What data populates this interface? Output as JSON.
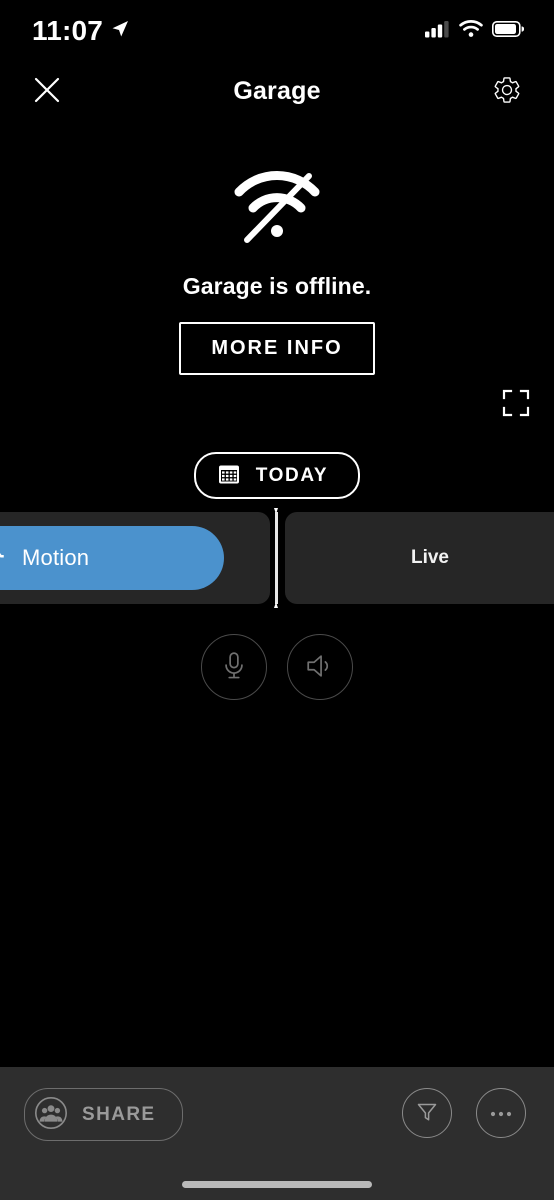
{
  "status_bar": {
    "time": "11:07",
    "location_icon": "location-arrow-icon",
    "signal_icon": "cellular-signal-icon",
    "signal_bars_filled": 2,
    "signal_bars_total": 4,
    "wifi_icon": "wifi-icon",
    "battery_icon": "battery-icon",
    "battery_level_percent": 85
  },
  "nav_bar": {
    "close_icon": "close-x-icon",
    "title": "Garage",
    "settings_icon": "gear-icon"
  },
  "offline_panel": {
    "icon": "wifi-off-icon",
    "message": "Garage is offline.",
    "more_info_label": "MORE INFO"
  },
  "viewer": {
    "fullscreen_icon": "fullscreen-expand-icon"
  },
  "date_selector": {
    "calendar_icon": "calendar-icon",
    "label": "TODAY"
  },
  "timeline": {
    "events": [
      {
        "type": "motion",
        "label": "Motion",
        "icon": "running-person-icon",
        "color": "#4b92cd"
      },
      {
        "type": "live",
        "label": "Live",
        "icon": "",
        "color": "#262626"
      }
    ],
    "playhead_label": "playhead"
  },
  "audio_controls": [
    {
      "name": "microphone",
      "icon": "microphone-icon",
      "enabled": false
    },
    {
      "name": "speaker",
      "icon": "speaker-icon",
      "enabled": false
    }
  ],
  "bottom_bar": {
    "share_label": "SHARE",
    "share_icon": "people-group-icon",
    "filter_icon": "funnel-filter-icon",
    "more_icon": "ellipsis-icon"
  },
  "colors": {
    "background": "#000000",
    "accent_blue": "#4b92cd",
    "card_gray": "#262626",
    "bottom_bar_gray": "#2e2e2e",
    "text_primary": "#ffffff",
    "text_muted": "#9a9a9a"
  }
}
